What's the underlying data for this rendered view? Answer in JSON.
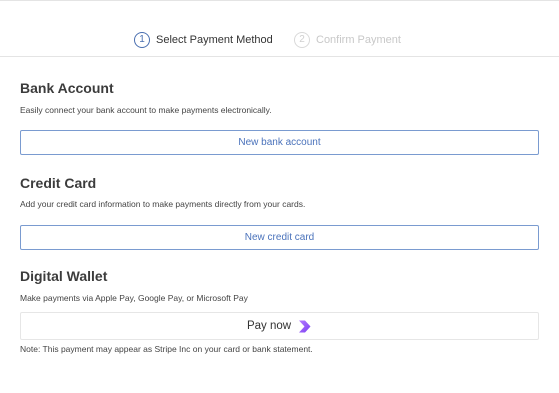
{
  "stepper": {
    "step1": {
      "number": "1",
      "label": "Select Payment Method",
      "active": true
    },
    "step2": {
      "number": "2",
      "label": "Confirm Payment",
      "active": false
    }
  },
  "bank": {
    "title": "Bank Account",
    "description": "Easily connect your bank account to make payments electronically.",
    "button_label": "New bank account"
  },
  "credit": {
    "title": "Credit Card",
    "description": "Add your credit card information to make payments directly from your cards.",
    "button_label": "New credit card"
  },
  "wallet": {
    "title": "Digital Wallet",
    "description": "Make payments via Apple Pay, Google Pay, or Microsoft Pay",
    "button_label": "Pay now",
    "button_icon": "pay-now-chevron-icon",
    "note": "Note: This payment may appear as Stripe Inc on your card or bank statement."
  },
  "colors": {
    "accent": "#4a72bb",
    "button_border": "#7a9bd0",
    "pay_icon": "#9b59f5"
  }
}
